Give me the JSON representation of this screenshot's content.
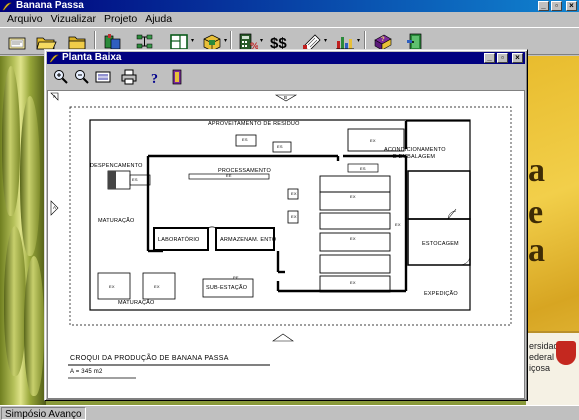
{
  "app": {
    "title": "Banana Passa"
  },
  "menu": [
    "Arquivo",
    "Vizualizar",
    "Projeto",
    "Ajuda"
  ],
  "window_buttons": {
    "minimize": "_",
    "restore": "▫",
    "close": "×"
  },
  "toolbar": {
    "icons": [
      "new-file-icon",
      "open-folder-icon",
      "folder-icon",
      "tools-icon",
      "flowchart-icon",
      "floor-plan-icon",
      "package-icon",
      "calculator-icon",
      "dollar-icon",
      "notepad-icon",
      "bar-chart-icon",
      "help-book-icon",
      "exit-door-icon"
    ]
  },
  "child_window": {
    "title": "Planta Baixa",
    "toolbar_icons": [
      "zoom-in-icon",
      "zoom-out-icon",
      "fit-view-icon",
      "print-icon",
      "help-icon",
      "exit-icon"
    ]
  },
  "plan": {
    "labels": {
      "aproveitamento": "APROVEITAMENTO DE RESÍDUO",
      "despencamento": "DESPENCAMENTO",
      "processamento": "PROCESSAMENTO",
      "maturacao": "MATURAÇÃO",
      "maturacao_2": "MATURAÇÃO",
      "lab": "LABORATÓRIO",
      "armazenamento": "ARMAZENAM. ENTO",
      "sub_estacao": "SUB-ESTAÇÃO",
      "acondicionamento": "ACONDICIONAMENTO E EMBALAGEM",
      "estocagem": "ESTOCAGEM",
      "expedicao": "EXPEDIÇÃO",
      "small_codes": [
        "ES",
        "ES",
        "EX",
        "EX",
        "EX",
        "EX",
        "EX",
        "EX",
        "EX",
        "EX",
        "EX",
        "ES",
        "EE",
        "PE",
        "ES"
      ]
    },
    "title": "CROQUI DA PRODUÇÃO DE BANANA PASSA",
    "subtitle": "A = 345 m2",
    "markers": [
      "A",
      "B"
    ]
  },
  "status": {
    "text": "Simpósio Avanço"
  },
  "background": {
    "letters": [
      "a",
      "e",
      "a"
    ],
    "crest_text": [
      "ersidade",
      "ederal",
      "içosa"
    ]
  }
}
